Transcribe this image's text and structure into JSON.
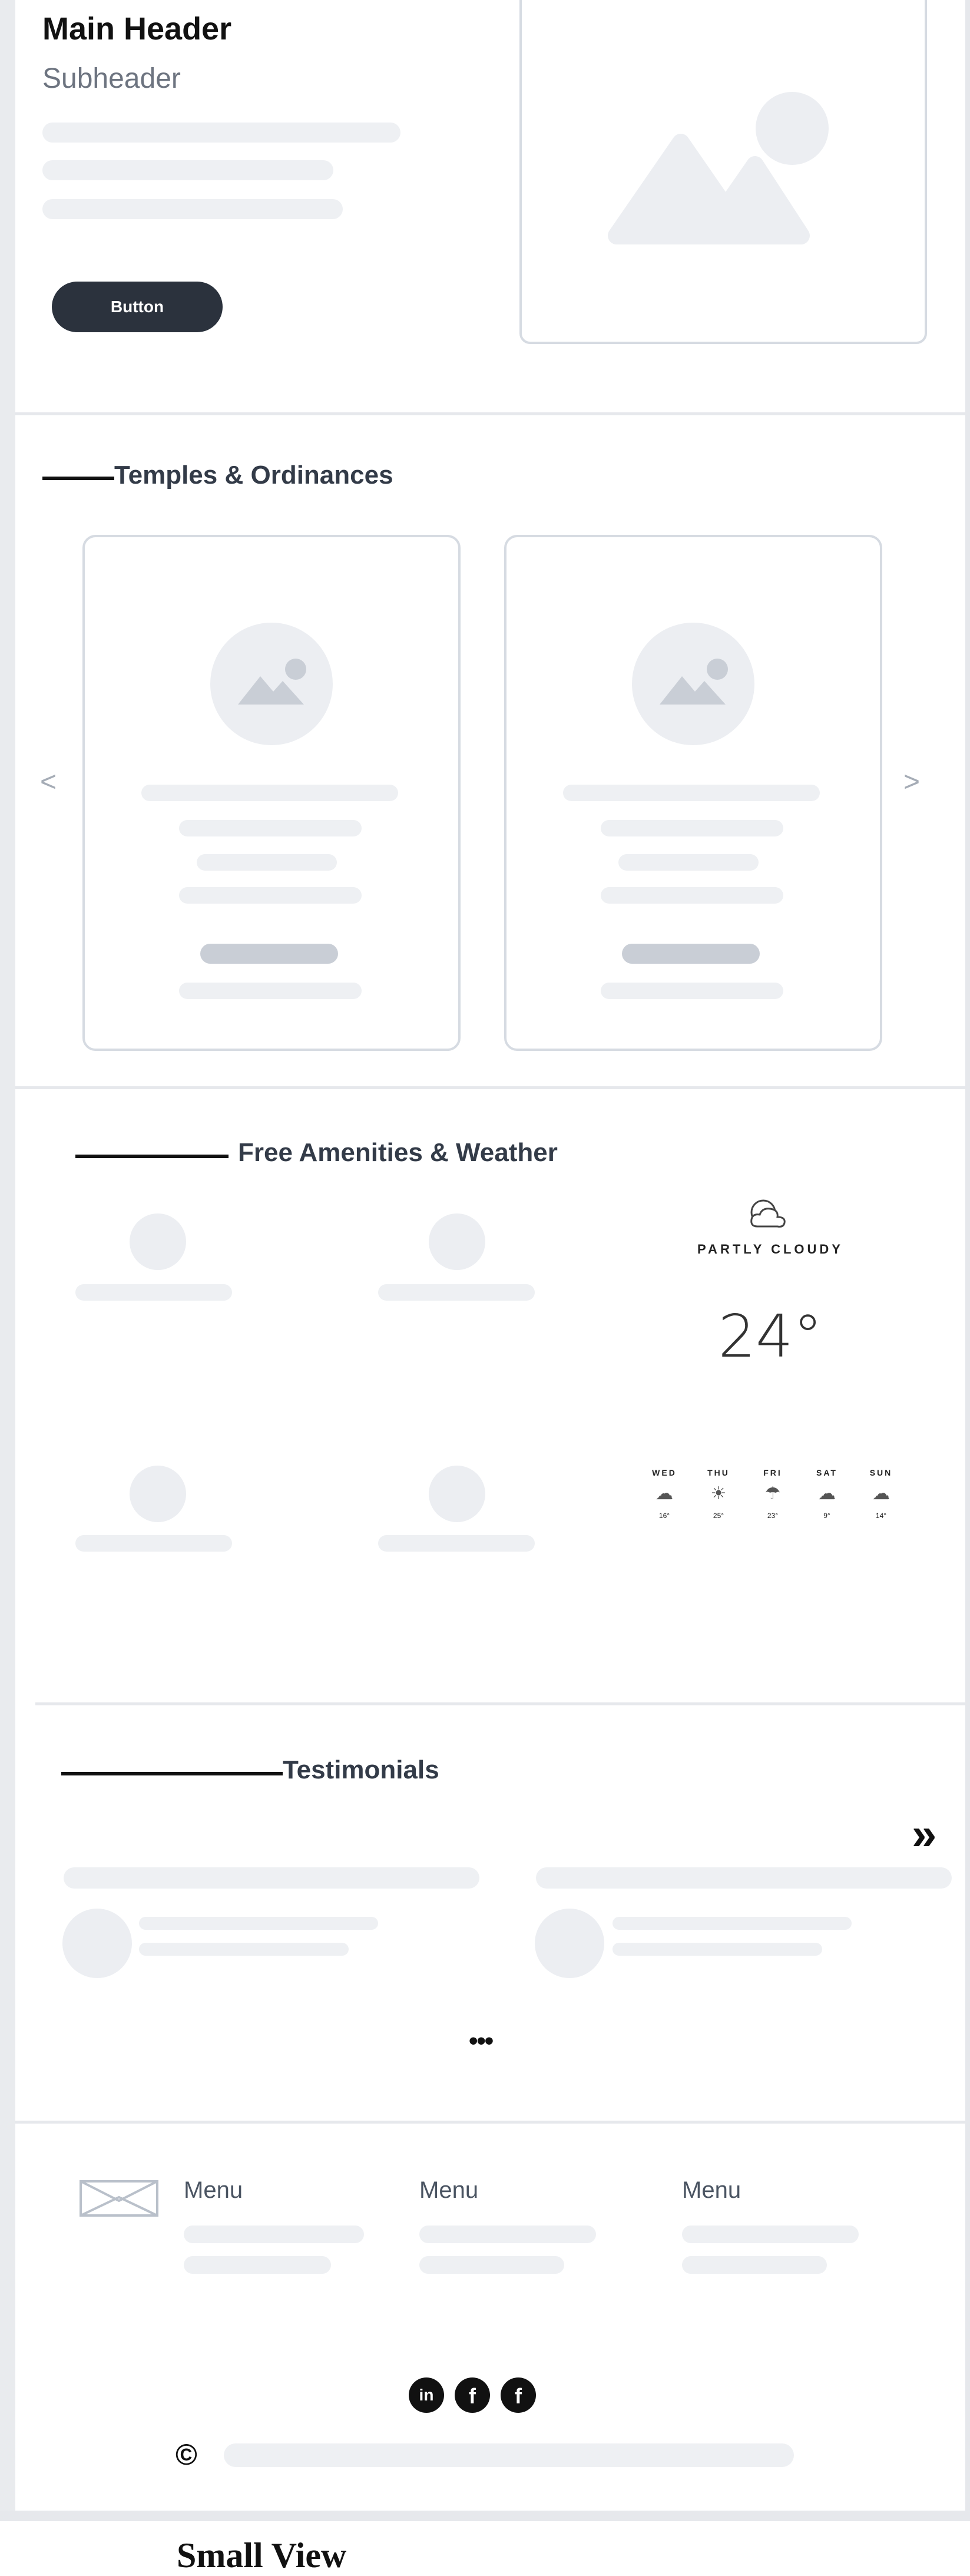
{
  "hero": {
    "title": "Main Header",
    "subtitle": "Subheader",
    "button_label": "Button"
  },
  "sections": {
    "temples_title": "Temples & Ordinances",
    "amenities_title": "Free Amenities & Weather",
    "testimonials_title": "Testimonials"
  },
  "carousel": {
    "prev_glyph": "<",
    "next_glyph": ">"
  },
  "weather": {
    "condition": "PARTLY CLOUDY",
    "temperature": "24°",
    "forecast": [
      {
        "day": "WED",
        "temp": "16°"
      },
      {
        "day": "THU",
        "temp": "25°"
      },
      {
        "day": "FRI",
        "temp": "23°"
      },
      {
        "day": "SAT",
        "temp": "9°"
      },
      {
        "day": "SUN",
        "temp": "14°"
      }
    ]
  },
  "testimonials": {
    "next_glyph": "»",
    "more_glyph": "•••"
  },
  "footer": {
    "menus": [
      "Menu",
      "Menu",
      "Menu"
    ],
    "social": [
      "in",
      "f",
      "f"
    ],
    "copyright_symbol": "©"
  },
  "caption": "Small View"
}
